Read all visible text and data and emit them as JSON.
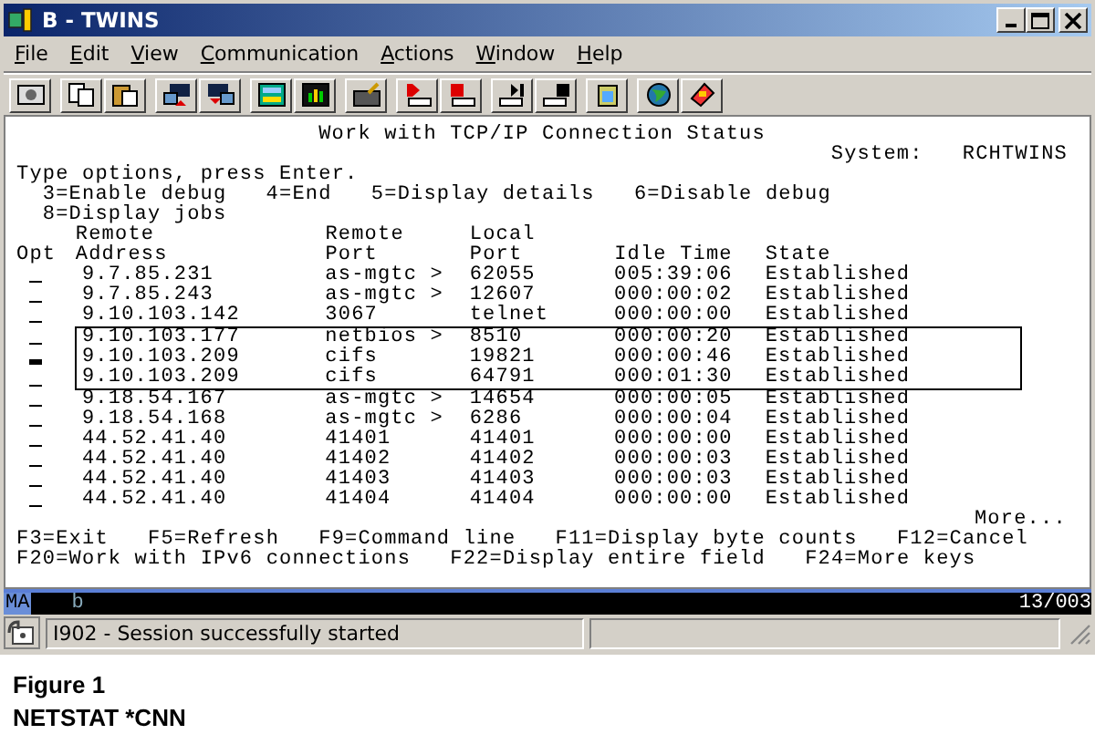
{
  "window": {
    "title": "B - TWINS"
  },
  "menu": [
    "File",
    "Edit",
    "View",
    "Communication",
    "Actions",
    "Window",
    "Help"
  ],
  "screen": {
    "title": "Work with TCP/IP Connection Status",
    "system_label": "System:",
    "system_name": "RCHTWINS",
    "instructions": "Type options, press Enter.",
    "options": [
      "3=Enable debug   4=End   5=Display details   6=Disable debug",
      "8=Display jobs"
    ],
    "columns": [
      {
        "bottom": "Opt"
      },
      {
        "top": "Remote",
        "bottom": "Address"
      },
      {
        "top": "Remote",
        "bottom": "Port"
      },
      {
        "top": "Local",
        "bottom": "Port"
      },
      {
        "bottom": "Idle Time"
      },
      {
        "bottom": "State"
      }
    ],
    "rows": [
      {
        "address": "9.7.85.231",
        "remote_port": "as-mgtc >",
        "local_port": "62055",
        "idle_time": "005:39:06",
        "state": "Established",
        "highlighted": false,
        "cursor": false
      },
      {
        "address": "9.7.85.243",
        "remote_port": "as-mgtc >",
        "local_port": "12607",
        "idle_time": "000:00:02",
        "state": "Established",
        "highlighted": false,
        "cursor": false
      },
      {
        "address": "9.10.103.142",
        "remote_port": "3067",
        "local_port": "telnet",
        "idle_time": "000:00:00",
        "state": "Established",
        "highlighted": false,
        "cursor": false
      },
      {
        "address": "9.10.103.177",
        "remote_port": "netbios >",
        "local_port": "8510",
        "idle_time": "000:00:20",
        "state": "Established",
        "highlighted": true,
        "cursor": false
      },
      {
        "address": "9.10.103.209",
        "remote_port": "cifs",
        "local_port": "19821",
        "idle_time": "000:00:46",
        "state": "Established",
        "highlighted": true,
        "cursor": true
      },
      {
        "address": "9.10.103.209",
        "remote_port": "cifs",
        "local_port": "64791",
        "idle_time": "000:01:30",
        "state": "Established",
        "highlighted": true,
        "cursor": false
      },
      {
        "address": "9.18.54.167",
        "remote_port": "as-mgtc >",
        "local_port": "14654",
        "idle_time": "000:00:05",
        "state": "Established",
        "highlighted": false,
        "cursor": false
      },
      {
        "address": "9.18.54.168",
        "remote_port": "as-mgtc >",
        "local_port": "6286",
        "idle_time": "000:00:04",
        "state": "Established",
        "highlighted": false,
        "cursor": false
      },
      {
        "address": "44.52.41.40",
        "remote_port": "41401",
        "local_port": "41401",
        "idle_time": "000:00:00",
        "state": "Established",
        "highlighted": false,
        "cursor": false
      },
      {
        "address": "44.52.41.40",
        "remote_port": "41402",
        "local_port": "41402",
        "idle_time": "000:00:03",
        "state": "Established",
        "highlighted": false,
        "cursor": false
      },
      {
        "address": "44.52.41.40",
        "remote_port": "41403",
        "local_port": "41403",
        "idle_time": "000:00:03",
        "state": "Established",
        "highlighted": false,
        "cursor": false
      },
      {
        "address": "44.52.41.40",
        "remote_port": "41404",
        "local_port": "41404",
        "idle_time": "000:00:00",
        "state": "Established",
        "highlighted": false,
        "cursor": false
      }
    ],
    "more": "More...",
    "function_keys": [
      "F3=Exit   F5=Refresh   F9=Command line   F11=Display byte counts   F12=Cancel",
      "F20=Work with IPv6 connections   F22=Display entire field   F24=More keys"
    ]
  },
  "operator_line": {
    "indicator": "MA",
    "marker": "b",
    "position": "13/003"
  },
  "status_bar": {
    "message": "I902 - Session successfully started"
  },
  "caption": {
    "title": "Figure 1",
    "subtitle": "NETSTAT *CNN"
  }
}
